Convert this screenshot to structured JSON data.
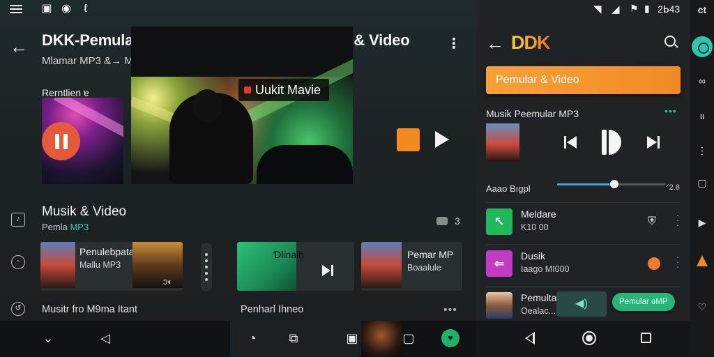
{
  "left": {
    "status_icons": [
      "menu-icon",
      "image-icon",
      "shield-icon",
      "mic-icon"
    ],
    "title": "DKK-Pemular MP3 Terbaikt Fartartur Musik & Video",
    "subtitle": "Mlamar MP3 &→ Mnsikgn, Mrala, &&ldidde",
    "playlist_label": "Rerntlien  ɐ",
    "video_badge": "Uukit Mavie",
    "section": {
      "title": "Musik & Video",
      "sub_prefix": "Pemla ",
      "sub_accent": "MP3",
      "count": "3"
    },
    "cards": [
      {
        "title": "Penulebpatabr2",
        "sub": "Mallu MP3",
        "extra": "ɔ◐"
      },
      {
        "title": "Ɗlinaih",
        "sub": ""
      },
      {
        "title": "Pemar MP",
        "sub": "Boaalule"
      }
    ],
    "bottom_row": {
      "left": "Musitr fro M9ma Itant",
      "right": "Penharl Ihneo"
    },
    "video_controls": [
      "▭ ↻",
      "⊏⊦"
    ]
  },
  "right": {
    "clock": "2ᖯ43",
    "logo": "DDK",
    "orange_bar": "Pemular & Video",
    "now_label": "Musik Peemular MP3",
    "progress_label": "Aaao Bıgpl",
    "progress": 0.53,
    "progress_time": "ᐟ2.8",
    "items": [
      {
        "name": "Meldare",
        "meta": "K10 00",
        "tile_color": "#21b85b",
        "tile_glyph": "↖"
      },
      {
        "name": "Dusik",
        "meta": "Iaago MI000",
        "tile_color": "#c23ac6",
        "tile_glyph": "⇐"
      },
      {
        "name": "Pemulta",
        "meta": "Oealac...",
        "tile_color": "#ffffff",
        "tile_glyph": ""
      }
    ],
    "chip": "Pemular ǝMP",
    "wave_glyph": "◀)"
  },
  "strip": {
    "top": "ct"
  }
}
